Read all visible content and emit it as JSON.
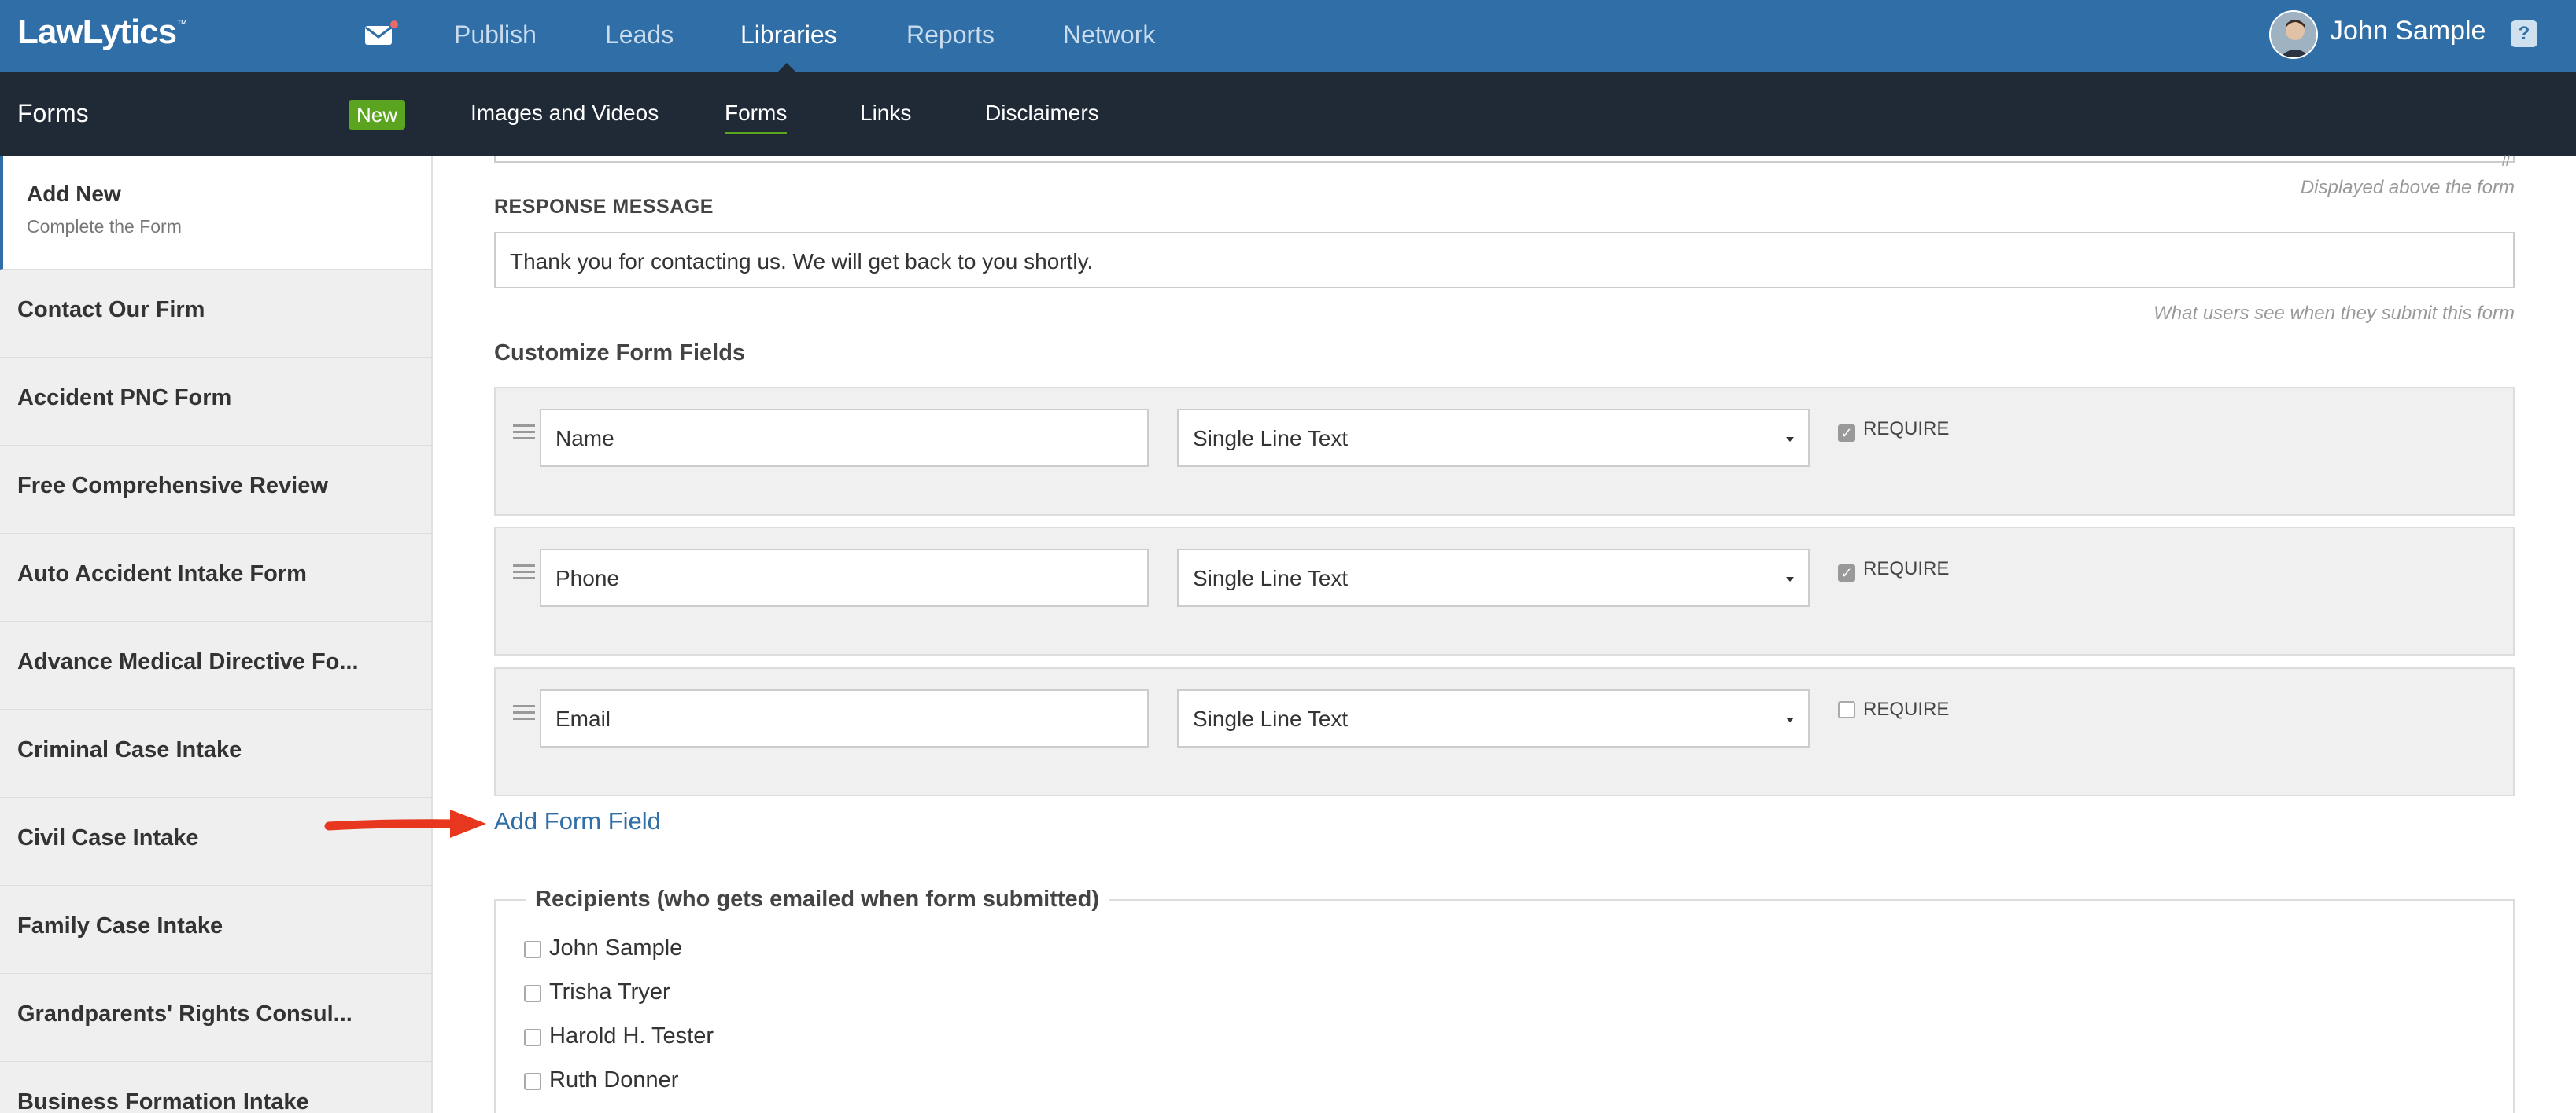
{
  "header": {
    "logo": "LawLytics",
    "logo_tm": "™",
    "nav": [
      "Publish",
      "Leads",
      "Libraries",
      "Reports",
      "Network"
    ],
    "active_nav": "Libraries",
    "user_name": "John Sample",
    "help": "?"
  },
  "subnav": {
    "title": "Forms",
    "new_badge": "New",
    "items": [
      "Images and Videos",
      "Forms",
      "Links",
      "Disclaimers"
    ],
    "active": "Forms"
  },
  "sidebar": {
    "add_new": {
      "title": "Add New",
      "subtitle": "Complete the Form"
    },
    "items": [
      "Contact Our Firm",
      "Accident PNC Form",
      "Free Comprehensive Review",
      "Auto Accident Intake Form",
      "Advance Medical Directive Fo...",
      "Criminal Case Intake",
      "Civil Case Intake",
      "Family Case Intake",
      "Grandparents' Rights Consul...",
      "Business Formation Intake"
    ]
  },
  "form": {
    "displayed_above_hint": "Displayed above the form",
    "response_label": "RESPONSE MESSAGE",
    "response_value": "Thank you for contacting us.  We will get back to you shortly.",
    "response_hint": "What users see when they submit this form",
    "customize_title": "Customize Form Fields",
    "require_label": "REQUIRE",
    "fields": [
      {
        "name": "Name",
        "type": "Single Line Text",
        "required": true
      },
      {
        "name": "Phone",
        "type": "Single Line Text",
        "required": true
      },
      {
        "name": "Email",
        "type": "Single Line Text",
        "required": false
      }
    ],
    "add_field_link": "Add Form Field",
    "recipients_legend": "Recipients (who gets emailed when form submitted)",
    "recipients": [
      "John Sample",
      "Trisha Tryer",
      "Harold H. Tester",
      "Ruth Donner"
    ]
  },
  "colors": {
    "topbar": "#2f6ea6",
    "subbar": "#1f2a36",
    "badge_new": "#5aa41f",
    "link": "#2f6ea6",
    "annotation_arrow": "#e8371f"
  }
}
